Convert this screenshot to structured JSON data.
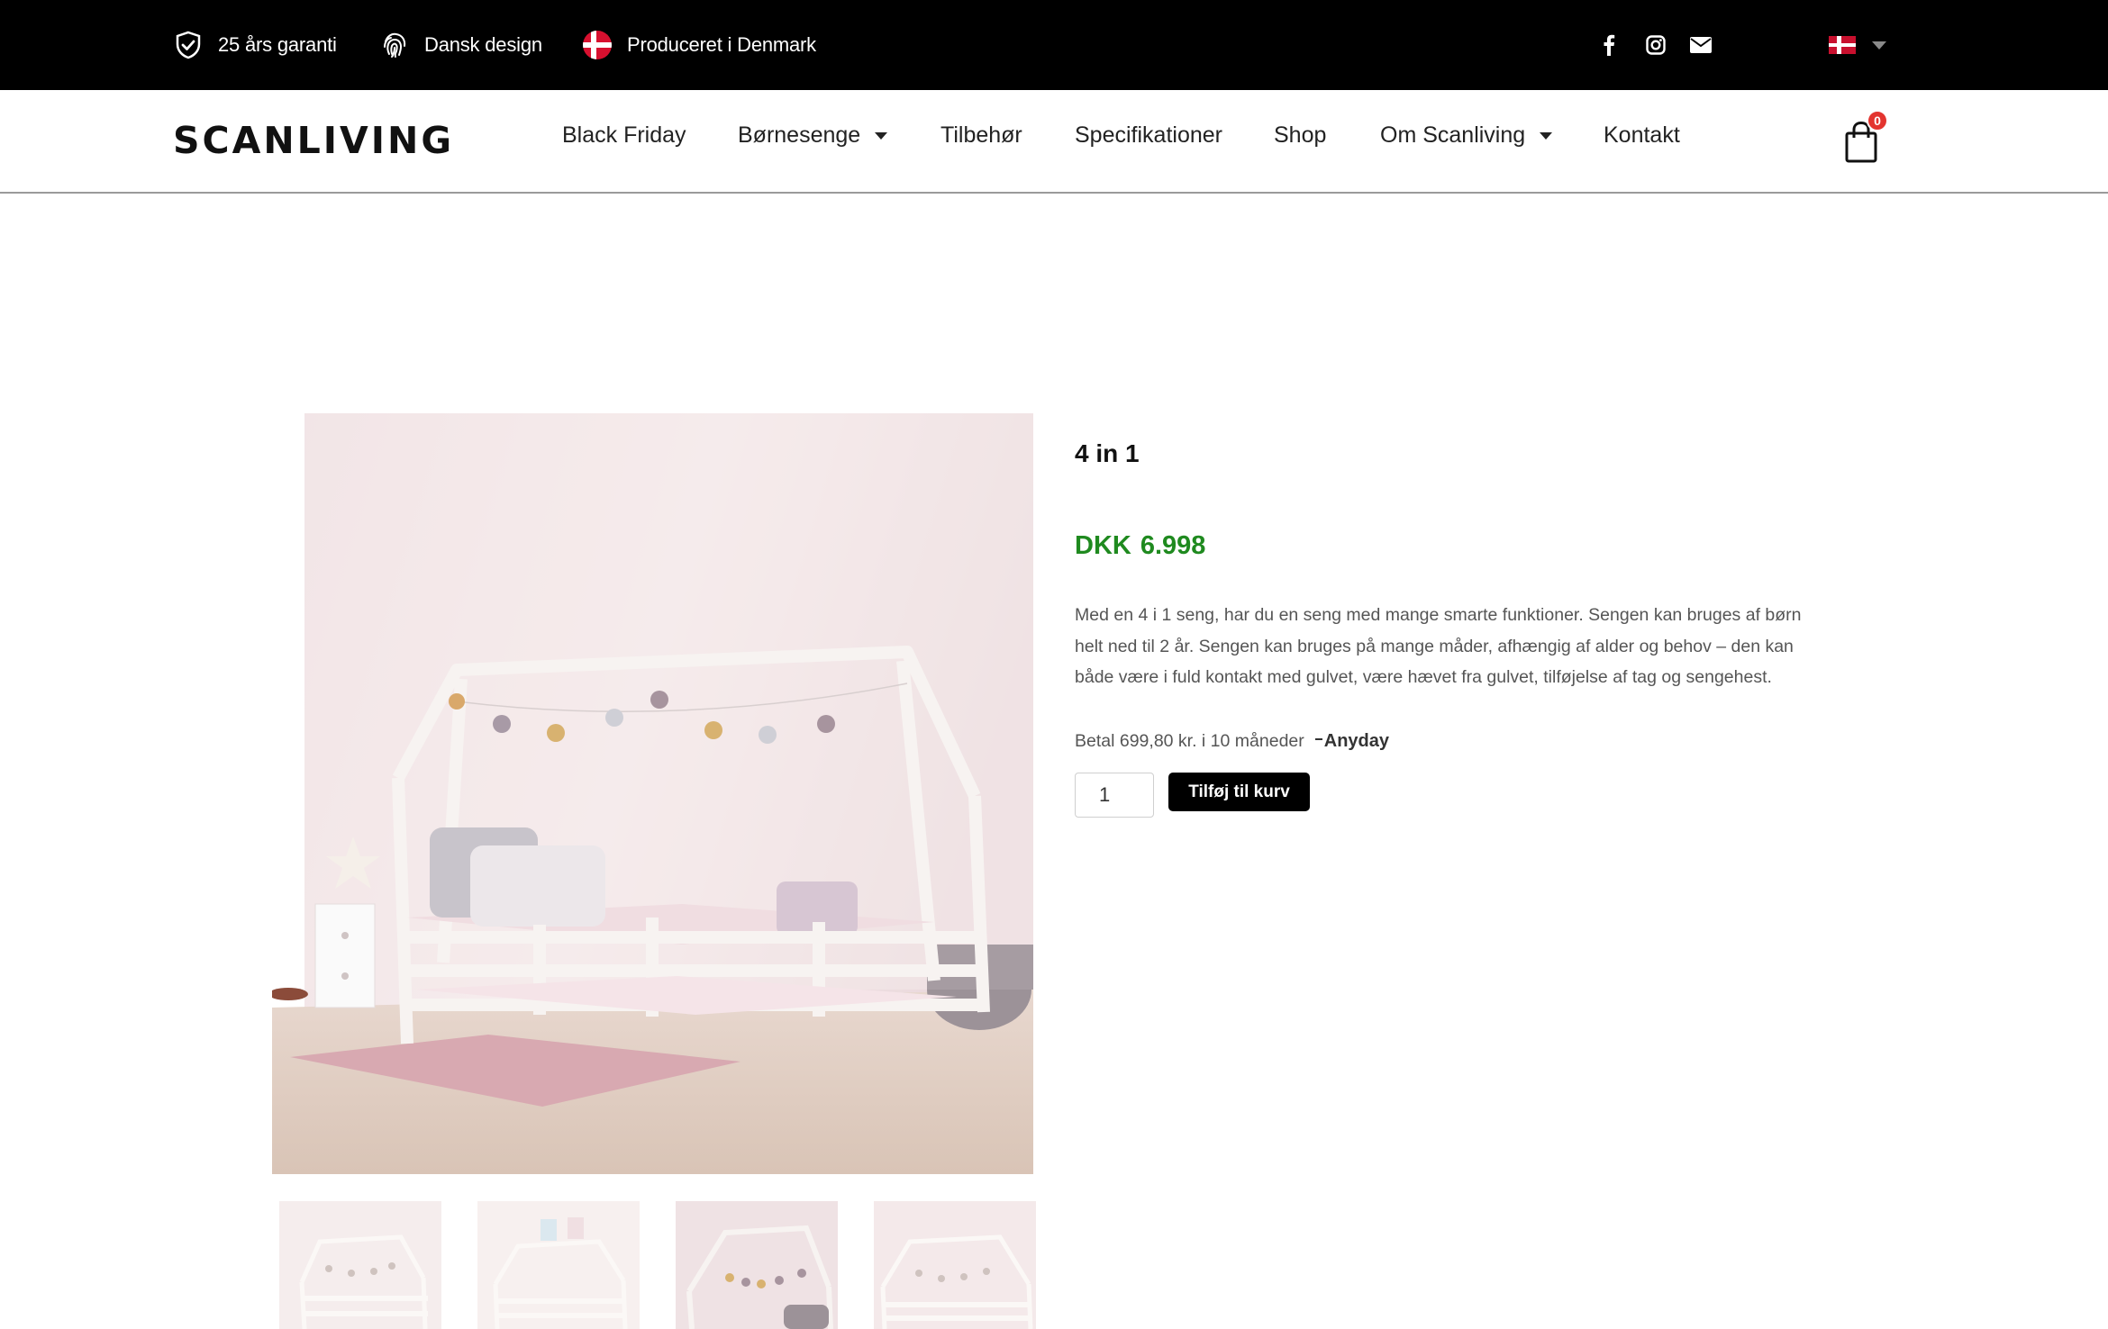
{
  "topbar": {
    "usps": [
      {
        "icon": "shield-check-icon",
        "label": "25 års garanti"
      },
      {
        "icon": "fingerprint-icon",
        "label": "Dansk design"
      },
      {
        "icon": "danish-flag-icon",
        "label": "Produceret i Denmark"
      }
    ],
    "social": [
      "facebook-icon",
      "instagram-icon",
      "envelope-icon"
    ],
    "language": {
      "flag": "danish-flag-icon"
    }
  },
  "nav": {
    "logo": "SCANLIVING",
    "items": [
      {
        "label": "Black Friday",
        "has_dropdown": false
      },
      {
        "label": "Børnesenge",
        "has_dropdown": true
      },
      {
        "label": "Tilbehør",
        "has_dropdown": false
      },
      {
        "label": "Specifikationer",
        "has_dropdown": false
      },
      {
        "label": "Shop",
        "has_dropdown": false
      },
      {
        "label": "Om Scanliving",
        "has_dropdown": true
      },
      {
        "label": "Kontakt",
        "has_dropdown": false
      }
    ],
    "cart_count": "0"
  },
  "product": {
    "title": "4 in 1",
    "currency": "DKK",
    "price": "6.998",
    "description": "Med en 4 i 1 seng, har du en seng med mange smarte funktioner. Sengen kan bruges af børn helt ned til 2 år. Sengen kan bruges på mange måder, afhængig af alder og behov – den kan både være i fuld kontakt med gulvet, være hævet fra gulvet, tilføjelse af tag og sengehest.",
    "installment": "Betal 699,80 kr. i 10 måneder",
    "installment_provider": "Anyday",
    "quantity": "1",
    "add_to_cart": "Tilføj til kurv",
    "thumbnail_count": 4
  },
  "colors": {
    "topbar_bg": "#000000",
    "price_green": "#1f8a1f",
    "button_bg": "#000000",
    "badge_red": "#e3342f"
  }
}
